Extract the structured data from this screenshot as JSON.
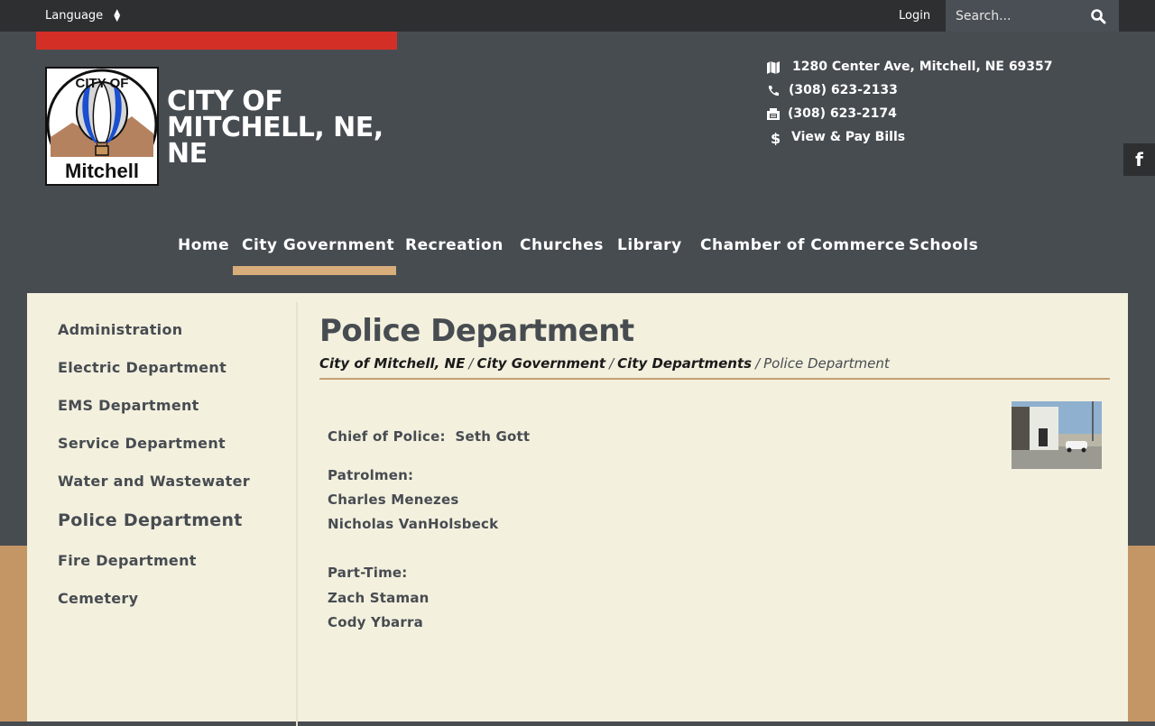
{
  "topbar": {
    "language_label": "Language",
    "login_label": "Login",
    "search_placeholder": "Search..."
  },
  "header": {
    "logo_text_top": "CITY OF",
    "logo_text_bottom": "Mitchell",
    "site_title": "CITY OF MITCHELL, NE, NE"
  },
  "contact": {
    "address": "1280 Center Ave, Mitchell, NE 69357",
    "phone": "(308) 623-2133",
    "fax": "(308) 623-2174",
    "bills": "View & Pay Bills"
  },
  "social": {
    "facebook_label": "f"
  },
  "nav": {
    "items": [
      {
        "label": "Home"
      },
      {
        "label": "City Government"
      },
      {
        "label": "Recreation"
      },
      {
        "label": "Churches"
      },
      {
        "label": "Library"
      },
      {
        "label": "Chamber of Commerce"
      },
      {
        "label": "Schools"
      }
    ],
    "active": "City Government"
  },
  "sidebar": {
    "items": [
      {
        "label": "Administration"
      },
      {
        "label": "Electric Department"
      },
      {
        "label": "EMS Department"
      },
      {
        "label": "Service Department"
      },
      {
        "label": "Water and Wastewater"
      },
      {
        "label": "Police Department"
      },
      {
        "label": "Fire Department"
      },
      {
        "label": "Cemetery"
      }
    ],
    "active": "Police Department"
  },
  "page": {
    "title": "Police Department",
    "breadcrumb": [
      "City of Mitchell, NE",
      "City Government",
      "City Departments",
      "Police Department"
    ],
    "breadcrumb_sep": "/",
    "chief_line": "Chief of Police:  Seth Gott",
    "patrolmen_heading": "Patrolmen:",
    "patrolmen": [
      "Charles Menezes",
      "Nicholas VanHolsbeck"
    ],
    "parttime_heading": "Part-Time:",
    "parttime": [
      "Zach Staman",
      "Cody Ybarra"
    ]
  },
  "colors": {
    "background": "#474c51",
    "topbar": "#2e2f31",
    "accent_red": "#d32f27",
    "accent_tan": "#d7ad7b",
    "content_bg": "#f3f0de",
    "text_dark": "#474c51"
  }
}
